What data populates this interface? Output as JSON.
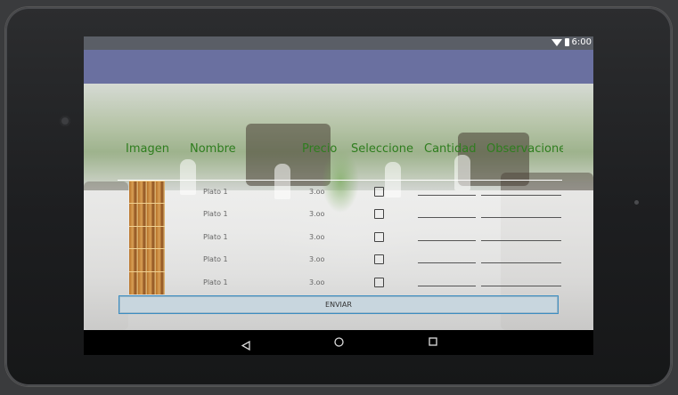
{
  "status_bar": {
    "time": "6:00",
    "wifi_icon": "wifi-icon",
    "battery_icon": "battery-icon"
  },
  "table": {
    "headers": {
      "image": "Imagen",
      "name": "Nombre",
      "price": "Precio",
      "select": "Seleccione",
      "quantity": "Cantidad",
      "notes": "Observaciones"
    },
    "rows": [
      {
        "name": "Plato 1",
        "price": "3.oo",
        "selected": false
      },
      {
        "name": "Plato 1",
        "price": "3.oo",
        "selected": false
      },
      {
        "name": "Plato 1",
        "price": "3.oo",
        "selected": false
      },
      {
        "name": "Plato 1",
        "price": "3.oo",
        "selected": false
      },
      {
        "name": "Plato 1",
        "price": "3.oo",
        "selected": false
      }
    ]
  },
  "submit_button": {
    "label": "ENVIAR"
  },
  "nav_bar": {
    "back_icon": "back-triangle-icon",
    "home_icon": "home-circle-icon",
    "recent_icon": "recent-apps-square-icon"
  },
  "colors": {
    "header_text": "#2e7d1e",
    "app_bar": "#6a70a0",
    "button_bg": "#c8d6de",
    "button_border": "#3d8ec2"
  }
}
